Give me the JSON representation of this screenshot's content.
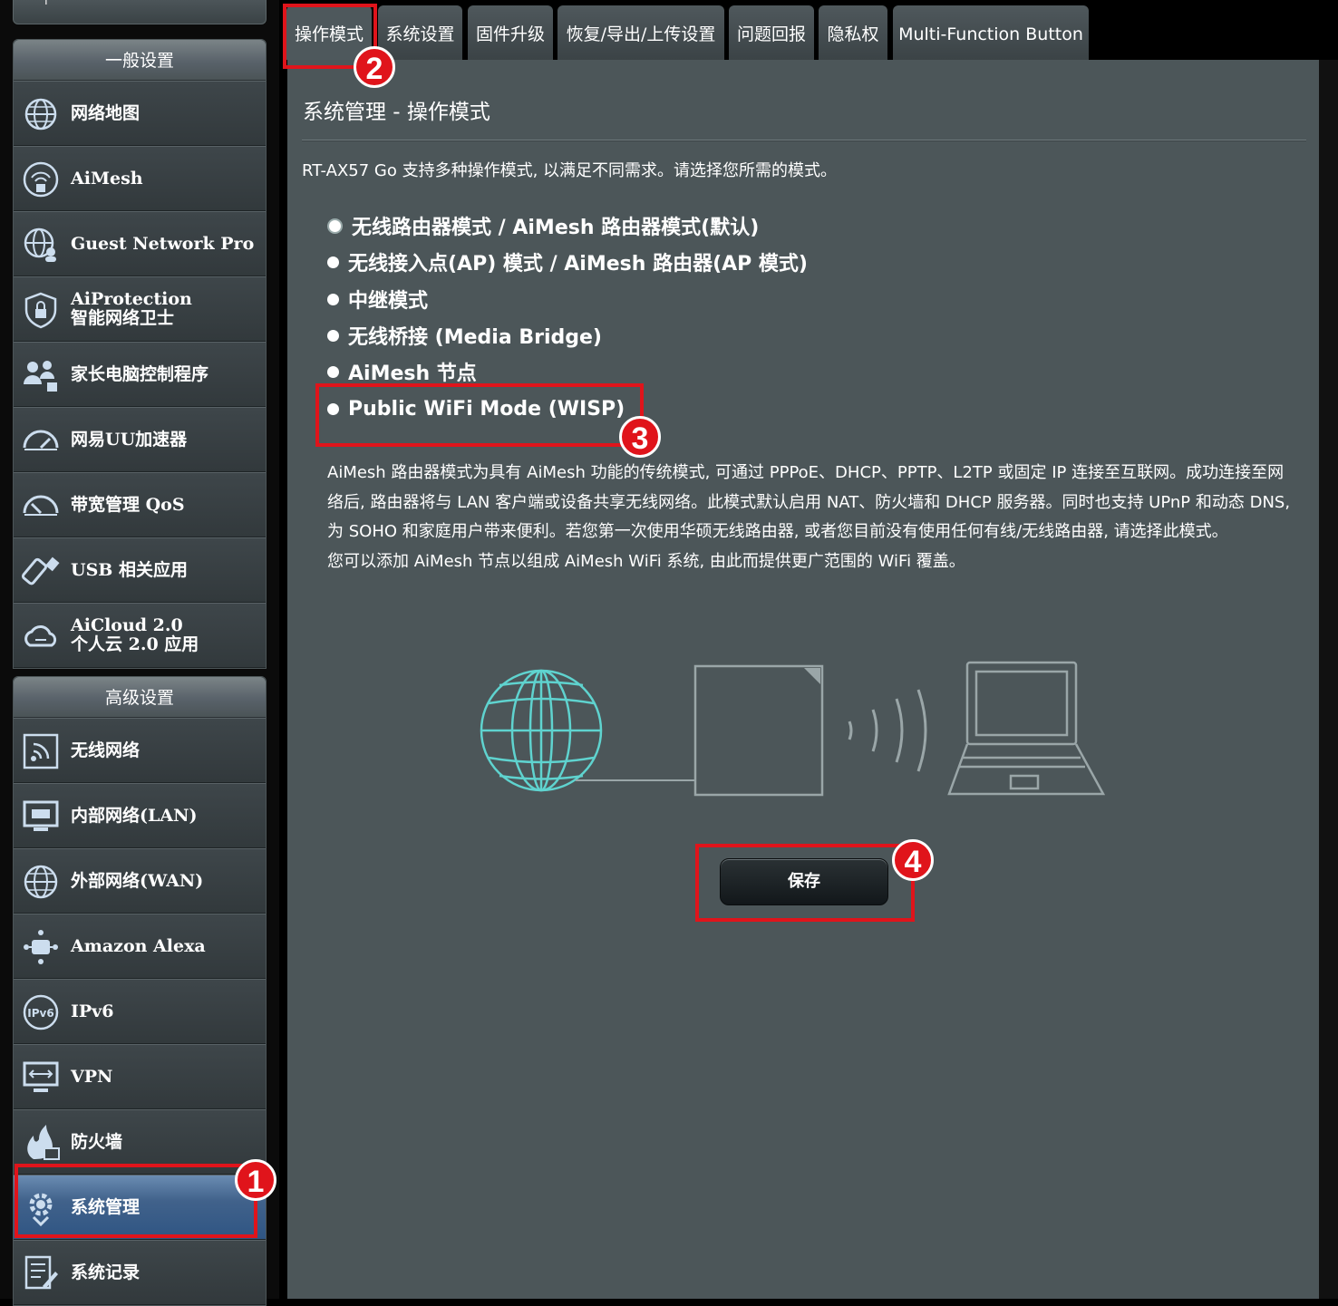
{
  "sidebar": {
    "general_header": "一般设置",
    "general_items": [
      {
        "label": "网络地图",
        "icon": "globe-network-icon"
      },
      {
        "label": "AiMesh",
        "icon": "aimesh-icon"
      },
      {
        "label": "Guest Network Pro",
        "icon": "guest-network-icon"
      },
      {
        "label": "AiProtection",
        "label2": "智能网络卫士",
        "icon": "shield-lock-icon"
      },
      {
        "label": "家长电脑控制程序",
        "icon": "parental-control-icon"
      },
      {
        "label": "网易UU加速器",
        "icon": "speedometer-icon"
      },
      {
        "label": "带宽管理 QoS",
        "icon": "gauge-icon"
      },
      {
        "label": "USB 相关应用",
        "icon": "usb-icon"
      },
      {
        "label": "AiCloud 2.0",
        "label2": "个人云 2.0 应用",
        "icon": "cloud-icon"
      }
    ],
    "advanced_header": "高级设置",
    "advanced_items": [
      {
        "label": "无线网络",
        "icon": "wireless-icon"
      },
      {
        "label": "内部网络(LAN)",
        "icon": "lan-icon"
      },
      {
        "label": "外部网络(WAN)",
        "icon": "wan-globe-icon"
      },
      {
        "label": "Amazon Alexa",
        "icon": "alexa-icon"
      },
      {
        "label": "IPv6",
        "icon": "ipv6-icon"
      },
      {
        "label": "VPN",
        "icon": "vpn-icon"
      },
      {
        "label": "防火墙",
        "icon": "firewall-icon"
      },
      {
        "label": "系统管理",
        "icon": "admin-gear-icon",
        "active": true
      },
      {
        "label": "系统记录",
        "icon": "system-log-icon"
      }
    ]
  },
  "tabs": [
    "操作模式",
    "系统设置",
    "固件升级",
    "恢复/导出/上传设置",
    "问题回报",
    "隐私权",
    "Multi-Function Button"
  ],
  "main": {
    "title": "系统管理 - 操作模式",
    "intro": "RT-AX57 Go 支持多种操作模式, 以满足不同需求。请选择您所需的模式。",
    "options": [
      "无线路由器模式 / AiMesh 路由器模式(默认)",
      "无线接入点(AP) 模式 / AiMesh 路由器(AP 模式)",
      "中继模式",
      "无线桥接 (Media Bridge)",
      "AiMesh 节点",
      "Public WiFi Mode (WISP)"
    ],
    "selected_option_index": 0,
    "description": [
      "AiMesh 路由器模式为具有 AiMesh 功能的传统模式, 可通过 PPPoE、DHCP、PPTP、L2TP 或固定 IP 连接至互联网。成功连接至网络后, 路由器将与 LAN 客户端或设备共享无线网络。此模式默认启用 NAT、防火墙和 DHCP 服务器。同时也支持 UPnP 和动态 DNS, 为 SOHO 和家庭用户带来便利。若您第一次使用华硕无线路由器, 或者您目前没有使用任何有线/无线路由器, 请选择此模式。",
      "您可以添加 AiMesh 节点以组成 AiMesh WiFi 系统, 由此而提供更广范围的 WiFi 覆盖。"
    ],
    "save_label": "保存"
  },
  "annotations": {
    "badge1": "1",
    "badge2": "2",
    "badge3": "3",
    "badge4": "4"
  },
  "colors": {
    "highlight": "#e0141b",
    "panel": "#4c5659",
    "active_menu": "#41628b",
    "illustration": "#5fd3cf"
  }
}
